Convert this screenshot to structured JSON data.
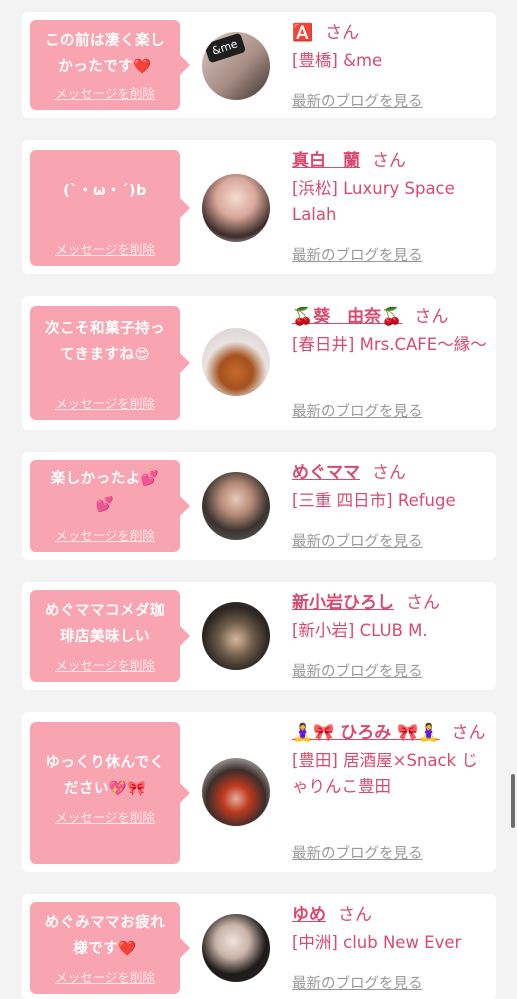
{
  "delete_label": "メッセージを削除",
  "blog_label": "最新のブログを見る",
  "honorific": "さん",
  "entries": [
    {
      "msg_lines": [
        "この前は凄く楽し",
        "かったです"
      ],
      "msg_emoji": "❤️",
      "name": "🅰️",
      "shop": "[豊橋] &me",
      "avatar_text": "&me"
    },
    {
      "msg_lines": [
        "(`・ω・´)b"
      ],
      "msg_emoji": "",
      "name": "真白　蘭",
      "shop": "[浜松] Luxury Space Lalah",
      "avatar_text": ""
    },
    {
      "msg_lines": [
        "次こそ和菓子持っ",
        "てきますね"
      ],
      "msg_emoji": "😍",
      "name": "🍒葵　由奈🍒",
      "shop": "[春日井] Mrs.CAFE〜縁〜",
      "avatar_text": ""
    },
    {
      "msg_lines": [
        "楽しかったよ💕",
        "💕"
      ],
      "msg_emoji": "",
      "name": "めぐママ",
      "shop": "[三重 四日市] Refuge",
      "avatar_text": ""
    },
    {
      "msg_lines": [
        "めぐママコメダ珈",
        "琲店美味しい"
      ],
      "msg_emoji": "",
      "name": "新小岩ひろし",
      "shop": "[新小岩] CLUB M.",
      "avatar_text": ""
    },
    {
      "msg_lines": [
        "ゆっくり休んでく",
        "ださい💖🎀"
      ],
      "msg_emoji": "",
      "name": "🧘‍♀️🎀 ひろみ 🎀🧘‍♀️",
      "shop": "[豊田] 居酒屋×Snack じゃりんこ豊田",
      "avatar_text": ""
    },
    {
      "msg_lines": [
        "めぐみママお疲れ",
        "様です"
      ],
      "msg_emoji": "❤️",
      "name": "ゆめ",
      "shop": "[中洲] club New Ever",
      "avatar_text": ""
    }
  ],
  "colors": {
    "bubble": "#f9a4b1",
    "accent": "#d94a6e",
    "link_gray": "#999999",
    "background": "#f3f3f3"
  }
}
